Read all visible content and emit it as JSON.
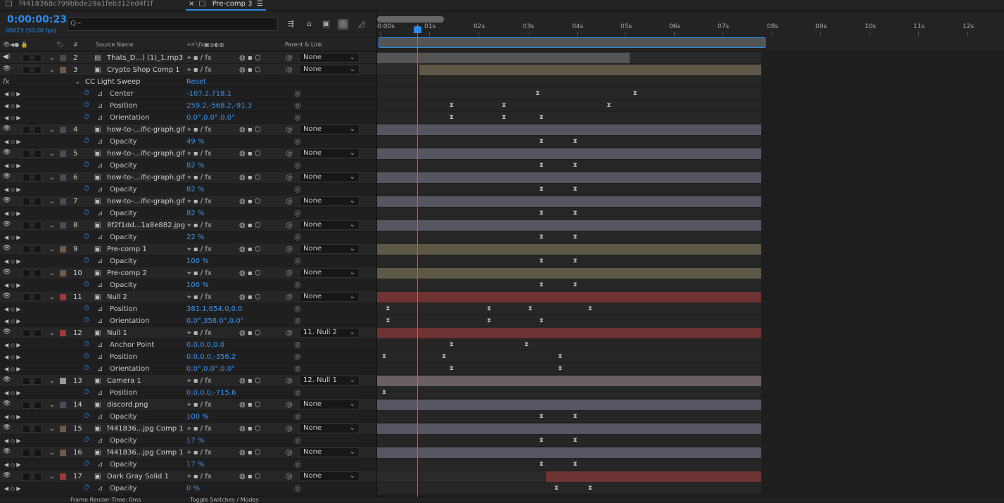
{
  "tabs": [
    {
      "label": "f4418368c799bbde29a1feb312ed4f1f"
    },
    {
      "label": "Pre-comp 3"
    }
  ],
  "timecode": "0:00:00:23",
  "frames": "00023 (30.00 fps)",
  "search": {
    "placeholder": "Q~"
  },
  "columns": {
    "source_name": "Source Name",
    "num": "#",
    "parent": "Parent & Link"
  },
  "ruler": [
    "0:00s",
    "01s",
    "02s",
    "03s",
    "04s",
    "05s",
    "06s",
    "07s",
    "08s",
    "09s",
    "10s",
    "11s",
    "12s"
  ],
  "rows": [
    {
      "kind": "layer",
      "num": "2",
      "name": "Thats_D...) (1)_1.mp3",
      "label": "#4a4a4a",
      "parent": "None",
      "audio": true,
      "bar": {
        "s": 0,
        "e": 0.658,
        "color": "#555555"
      }
    },
    {
      "kind": "layer",
      "num": "3",
      "name": "Crypto Shop Comp 1",
      "label": "#6e5a4a",
      "parent": "None",
      "bar": {
        "s": 0.11,
        "e": 1.0,
        "color": "#5e5848"
      }
    },
    {
      "kind": "effect",
      "name": "CC Light Sweep",
      "value": "Reset"
    },
    {
      "kind": "prop",
      "name": "Center",
      "value": "-107.2,718.1",
      "kf": [
        0.41,
        0.67
      ]
    },
    {
      "kind": "prop",
      "name": "Position",
      "value": "259.2,-568.2,-91.3",
      "kf": [
        0.18,
        0.32,
        0.6
      ]
    },
    {
      "kind": "prop",
      "name": "Orientation",
      "value": "0.0°,0.0°,0.0°",
      "kf": [
        0.18,
        0.32,
        0.42
      ]
    },
    {
      "kind": "layer",
      "num": "4",
      "name": "how-to-...ific-graph.gif",
      "label": "#4a4a58",
      "parent": "None",
      "bar": {
        "s": 0,
        "e": 1.0,
        "color": "#565663"
      }
    },
    {
      "kind": "prop",
      "name": "Opacity",
      "value": "49 %",
      "kf": [
        0.42,
        0.51
      ]
    },
    {
      "kind": "layer",
      "num": "5",
      "name": "how-to-...ific-graph.gif",
      "label": "#4a4a58",
      "parent": "None",
      "bar": {
        "s": 0,
        "e": 1.0,
        "color": "#565663"
      }
    },
    {
      "kind": "prop",
      "name": "Opacity",
      "value": "82 %",
      "kf": [
        0.42,
        0.51
      ]
    },
    {
      "kind": "layer",
      "num": "6",
      "name": "how-to-...ific-graph.gif",
      "label": "#4a4a58",
      "parent": "None",
      "bar": {
        "s": 0,
        "e": 1.0,
        "color": "#565663"
      }
    },
    {
      "kind": "prop",
      "name": "Opacity",
      "value": "82 %",
      "kf": [
        0.42,
        0.51
      ]
    },
    {
      "kind": "layer",
      "num": "7",
      "name": "how-to-...ific-graph.gif",
      "label": "#4a4a58",
      "parent": "None",
      "bar": {
        "s": 0,
        "e": 1.0,
        "color": "#565663"
      }
    },
    {
      "kind": "prop",
      "name": "Opacity",
      "value": "82 %",
      "kf": [
        0.42,
        0.51
      ]
    },
    {
      "kind": "layer",
      "num": "8",
      "name": "8f2f1dd...1a8e882.jpg",
      "label": "#4a4a58",
      "parent": "None",
      "bar": {
        "s": 0,
        "e": 1.0,
        "color": "#565663"
      }
    },
    {
      "kind": "prop",
      "name": "Opacity",
      "value": "22 %",
      "kf": [
        0.42,
        0.51
      ]
    },
    {
      "kind": "layer",
      "num": "9",
      "name": "Pre-comp 1",
      "label": "#6e5a4a",
      "parent": "None",
      "bar": {
        "s": 0,
        "e": 1.0,
        "color": "#5e5848"
      }
    },
    {
      "kind": "prop",
      "name": "Opacity",
      "value": "100 %",
      "kf": [
        0.42,
        0.51
      ]
    },
    {
      "kind": "layer",
      "num": "10",
      "name": "Pre-comp 2",
      "label": "#6e5a4a",
      "parent": "None",
      "bar": {
        "s": 0,
        "e": 1.0,
        "color": "#5e5848"
      }
    },
    {
      "kind": "prop",
      "name": "Opacity",
      "value": "100 %",
      "kf": [
        0.42,
        0.51
      ]
    },
    {
      "kind": "layer",
      "num": "11",
      "name": "Null 2",
      "label": "#9a3a3a",
      "parent": "None",
      "bar": {
        "s": 0,
        "e": 1.0,
        "color": "#6e3333"
      }
    },
    {
      "kind": "prop",
      "name": "Position",
      "value": "381.1,654.0,0.0",
      "kf": [
        0.01,
        0.28,
        0.39,
        0.55
      ]
    },
    {
      "kind": "prop",
      "name": "Orientation",
      "value": "0.0°,358.0°,0.0°",
      "kf": [
        0.01,
        0.28,
        0.42
      ]
    },
    {
      "kind": "layer",
      "num": "12",
      "name": "Null 1",
      "label": "#9a3a3a",
      "parent": "11. Null 2",
      "bar": {
        "s": 0,
        "e": 1.0,
        "color": "#6e3333"
      }
    },
    {
      "kind": "prop",
      "name": "Anchor Point",
      "value": "0.0,0.0,0.0",
      "kf": [
        0.18,
        0.38
      ]
    },
    {
      "kind": "prop",
      "name": "Position",
      "value": "0.0,0.0,-356.2",
      "kf": [
        0.0,
        0.16,
        0.47
      ]
    },
    {
      "kind": "prop",
      "name": "Orientation",
      "value": "0.0°,0.0°,0.0°",
      "kf": [
        0.18,
        0.47
      ]
    },
    {
      "kind": "layer",
      "num": "13",
      "name": "Camera 1",
      "label": "#999999",
      "parent": "12. Null 1",
      "bar": {
        "s": 0,
        "e": 1.0,
        "color": "#6a6064"
      }
    },
    {
      "kind": "prop",
      "name": "Position",
      "value": "0.0,0.0,-715.6",
      "kf": [
        0.0
      ]
    },
    {
      "kind": "layer",
      "num": "14",
      "name": "discord.png",
      "label": "#4a4a58",
      "parent": "None",
      "bar": {
        "s": 0,
        "e": 1.0,
        "color": "#565663"
      }
    },
    {
      "kind": "prop",
      "name": "Opacity",
      "value": "100 %",
      "kf": [
        0.42,
        0.51
      ]
    },
    {
      "kind": "layer",
      "num": "15",
      "name": "f441836...jpg Comp 1",
      "label": "#6e5a4a",
      "parent": "None",
      "bar": {
        "s": 0,
        "e": 1.0,
        "color": "#565663"
      }
    },
    {
      "kind": "prop",
      "name": "Opacity",
      "value": "17 %",
      "kf": [
        0.42,
        0.51
      ]
    },
    {
      "kind": "layer",
      "num": "16",
      "name": "f441836...jpg Comp 1",
      "label": "#6e5a4a",
      "parent": "None",
      "bar": {
        "s": 0,
        "e": 1.0,
        "color": "#565663"
      }
    },
    {
      "kind": "prop",
      "name": "Opacity",
      "value": "17 %",
      "kf": [
        0.42,
        0.51
      ]
    },
    {
      "kind": "layer",
      "num": "17",
      "name": "Dark Gray Solid 1",
      "label": "#9a3a3a",
      "parent": "None",
      "bar": {
        "s": 0.44,
        "e": 1.0,
        "color": "#6e3333"
      }
    },
    {
      "kind": "prop",
      "name": "Opacity",
      "value": "0 %",
      "kf": [
        0.46,
        0.55
      ]
    }
  ],
  "status": {
    "frame_render": "Frame Render Time: 0ms",
    "toggle": "Toggle Switches / Modes"
  }
}
